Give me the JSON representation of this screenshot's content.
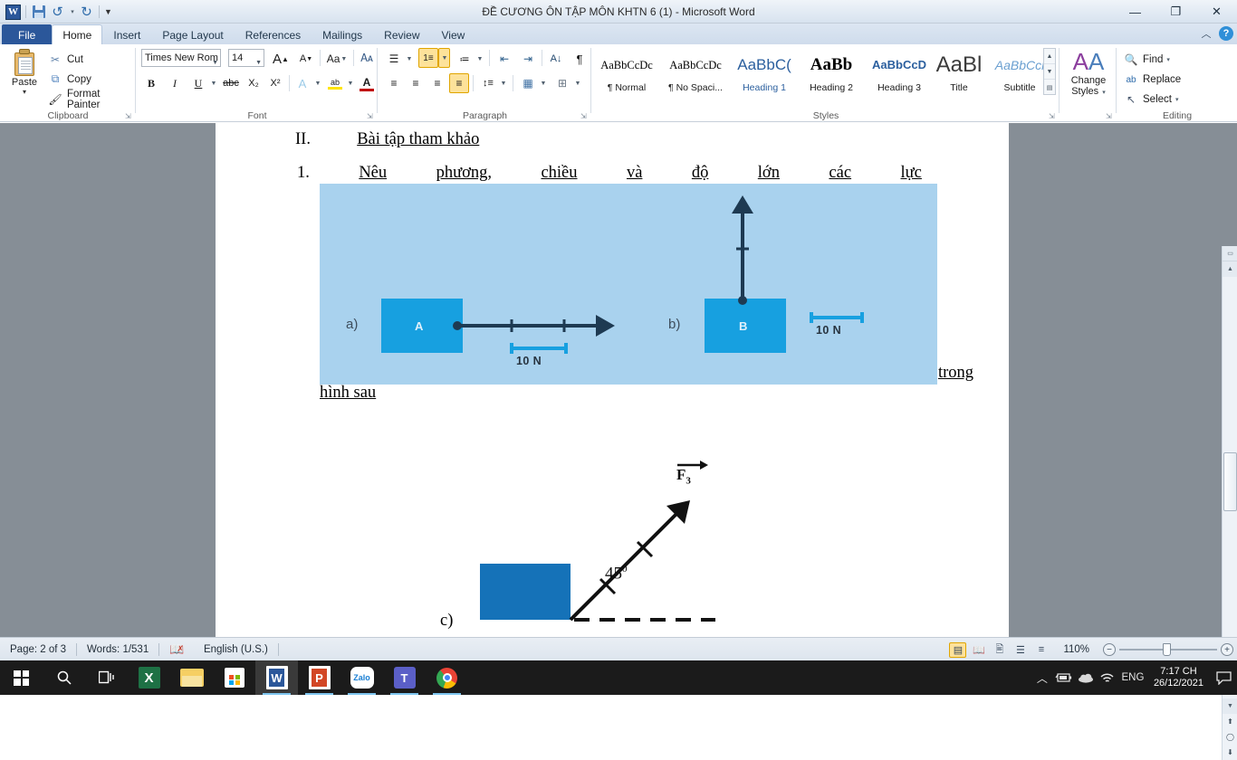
{
  "window": {
    "title": "ĐỀ CƯƠNG ÔN TẬP MÔN KHTN 6 (1)  -  Microsoft Word",
    "minimize": "—",
    "maximize": "❐",
    "close": "✕",
    "help": "?",
    "ribbon_collapse": "︿"
  },
  "quick_access": {
    "word_logo": "W",
    "save": "save-icon",
    "undo": "↺",
    "redo": "↻",
    "customize": "▾"
  },
  "tabs": [
    {
      "label": "File",
      "active": false,
      "file": true
    },
    {
      "label": "Home",
      "active": true
    },
    {
      "label": "Insert",
      "active": false
    },
    {
      "label": "Page Layout",
      "active": false
    },
    {
      "label": "References",
      "active": false
    },
    {
      "label": "Mailings",
      "active": false
    },
    {
      "label": "Review",
      "active": false
    },
    {
      "label": "View",
      "active": false
    }
  ],
  "ribbon": {
    "clipboard": {
      "group_label": "Clipboard",
      "paste_label": "Paste",
      "paste_arrow": "▾",
      "items": [
        {
          "label": "Cut",
          "icon": "✂"
        },
        {
          "label": "Copy",
          "icon": "⧉"
        },
        {
          "label": "Format Painter",
          "icon": "🖌"
        }
      ]
    },
    "font": {
      "group_label": "Font",
      "font_name": "Times New Rom",
      "font_size": "14",
      "grow_font": "A",
      "shrink_font": "A",
      "change_case": "Aa",
      "clear_formatting": "A",
      "bold": "B",
      "italic": "I",
      "underline": "U",
      "strikethrough": "abc",
      "subscript": "X₂",
      "superscript": "X²",
      "text_effects": "A",
      "highlight": "ab",
      "font_color": "A"
    },
    "paragraph": {
      "group_label": "Paragraph",
      "bullets": "☰",
      "numbering": "1≡",
      "multilevel": "≔",
      "decrease_indent": "⇤",
      "increase_indent": "⇥",
      "sort": "A↓",
      "show_marks": "¶",
      "align_left": "≡",
      "align_center": "≡",
      "align_right": "≡",
      "justify": "≡",
      "line_spacing": "↕≡",
      "shading": "▦",
      "borders": "⊞"
    },
    "styles": {
      "group_label": "Styles",
      "items": [
        {
          "preview": "AaBbCcDc",
          "name": "¶ Normal"
        },
        {
          "preview": "AaBbCcDc",
          "name": "¶ No Spaci..."
        },
        {
          "preview": "AaBbC(",
          "name": "Heading 1"
        },
        {
          "preview": "AaBb",
          "name": "Heading 2"
        },
        {
          "preview": "AaBbCcD",
          "name": "Heading 3"
        },
        {
          "preview": "AaBl",
          "name": "Title"
        },
        {
          "preview": "AaBbCcl",
          "name": "Subtitle"
        }
      ],
      "scroll_up": "▲",
      "scroll_down": "▼",
      "more": "▤"
    },
    "change_styles": {
      "label_line1": "Change",
      "label_line2": "Styles",
      "arrow": "▾"
    },
    "editing": {
      "group_label": "Editing",
      "items": [
        {
          "label": "Find",
          "icon": "🔍",
          "arrow": "▾"
        },
        {
          "label": "Replace",
          "icon": "ab"
        },
        {
          "label": "Select",
          "icon": "↖",
          "arrow": "▾"
        }
      ]
    }
  },
  "document": {
    "heading_number": "II.",
    "heading_text": "Bài tập tham khảo",
    "item_number": "1.",
    "question_words": [
      "Nêu",
      "phương,",
      "chiều",
      "và",
      "độ",
      "lớn",
      "các",
      "lực"
    ],
    "question_tail": "trong",
    "question_end": "hình sau",
    "figure_ab": {
      "label_a": "a)",
      "box_a": "A",
      "scale_a": "10 N",
      "label_b": "b)",
      "box_b": "B",
      "scale_b": "10 N"
    },
    "figure_c": {
      "vector_label": "F",
      "vector_sub": "3",
      "angle": "45",
      "angle_sup": "0",
      "label_c": "c)"
    }
  },
  "status_bar": {
    "page": "Page: 2 of 3",
    "words": "Words: 1/531",
    "proofing_icon": "spell-check-icon",
    "language": "English (U.S.)",
    "zoom_level": "110%",
    "zoom_out": "−",
    "zoom_in": "+",
    "views": [
      "print-layout",
      "full-screen-reading",
      "web-layout",
      "outline",
      "draft"
    ]
  },
  "taskbar": {
    "start": "⊞",
    "search": "search-icon",
    "task_view": "task-view-icon",
    "apps": [
      {
        "name": "excel",
        "glyph": "X",
        "running": false
      },
      {
        "name": "file-explorer",
        "glyph": "🗀",
        "running": false
      },
      {
        "name": "microsoft-store",
        "glyph": "🛍",
        "running": false
      },
      {
        "name": "word",
        "glyph": "W",
        "running": true,
        "active": true
      },
      {
        "name": "powerpoint",
        "glyph": "P",
        "running": true
      },
      {
        "name": "zalo",
        "glyph": "Zalo",
        "running": true
      },
      {
        "name": "teams",
        "glyph": "T",
        "running": true
      },
      {
        "name": "chrome",
        "glyph": "◉",
        "running": true
      }
    ],
    "tray": {
      "chevron": "︿",
      "battery": "battery-icon",
      "onedrive": "cloud-icon",
      "wifi": "wifi-icon",
      "language": "ENG",
      "time": "7:17 CH",
      "date": "26/12/2021",
      "notifications": "notification-icon"
    }
  },
  "colors": {
    "word_blue": "#2b579a",
    "figure_bg": "#a9d2ee",
    "block_blue": "#17a0e0",
    "block_dark_blue": "#1572b8",
    "arrow_navy": "#1e3a52",
    "accent_yellow": "#fde29a"
  }
}
